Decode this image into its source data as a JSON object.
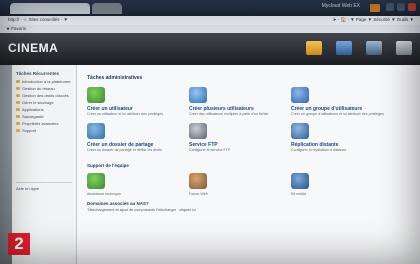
{
  "browser": {
    "tab_title": "",
    "window_title": "Mycloud Web EX",
    "address": "http://  ·  ☆  Sites conseillés  ·  ▼",
    "nav": "➤  ·  🏠  ·  ▼  Page ▼  Sécurité ▼  Outils ▼",
    "favorites": "★ Favoris"
  },
  "app": {
    "logo": "CINEMA",
    "accent": "#1a4a86",
    "header_icons": [
      "folder-icon",
      "monitor-icon",
      "settings-icon",
      "network-icon"
    ]
  },
  "sidebar": {
    "heading": "Tâches Récurrentes",
    "items": [
      "Introduction à la plateforme",
      "Gestion du réseau",
      "Gestion des droits d'accès",
      "Gérer le stockage",
      "Applications",
      "Sauvegarde",
      "Propriétés avancées",
      "Support"
    ],
    "misc": "Aide en ligne"
  },
  "main": {
    "section1": "Tâches administratives",
    "tasks_row1": [
      {
        "label": "Créer un utilisateur",
        "desc": "Créer un utilisateur et lui attribuer des privilèges",
        "icon": "user-add-icon",
        "color": "#3c8a2e"
      },
      {
        "label": "Créer plusieurs utilisateurs",
        "desc": "Créer des utilisateurs multiples à partir d'un fichier",
        "icon": "users-add-icon",
        "color": "#2f6db4"
      },
      {
        "label": "Créer un groupe d'utilisateurs",
        "desc": "Créer un groupe d'utilisateurs et lui attribuer des privilèges",
        "icon": "group-add-icon",
        "color": "#2c64ad"
      }
    ],
    "tasks_row2": [
      {
        "label": "Créer un dossier de partage",
        "desc": "Créer un dossier de partage et définir les droits",
        "icon": "share-folder-icon",
        "color": "#2d6fa8"
      },
      {
        "label": "Service FTP",
        "desc": "Configurer le serveur FTP",
        "icon": "ftp-icon",
        "color": "#5a6470"
      },
      {
        "label": "Réplication distante",
        "desc": "Configurer la réplication à distance",
        "icon": "replication-icon",
        "color": "#2e5f99"
      }
    ],
    "section2": "Support de l'équipe",
    "tasks_row3": [
      {
        "label": "Assistance technique",
        "desc": "",
        "icon": "support-icon",
        "color": "#3c8a2e"
      },
      {
        "label": "Forum Web",
        "desc": "",
        "icon": "forum-icon",
        "color": "#7d5a3a"
      },
      {
        "label": "Kit média",
        "desc": "",
        "icon": "media-icon",
        "color": "#24568f"
      }
    ],
    "banner_title": "Domaines associés au NAS?",
    "banner_sub": "Téléchargement et ajout de composants    Télécharger   ·   cliquez ici"
  },
  "overlay": {
    "number": "2",
    "color": "#e2202b"
  }
}
